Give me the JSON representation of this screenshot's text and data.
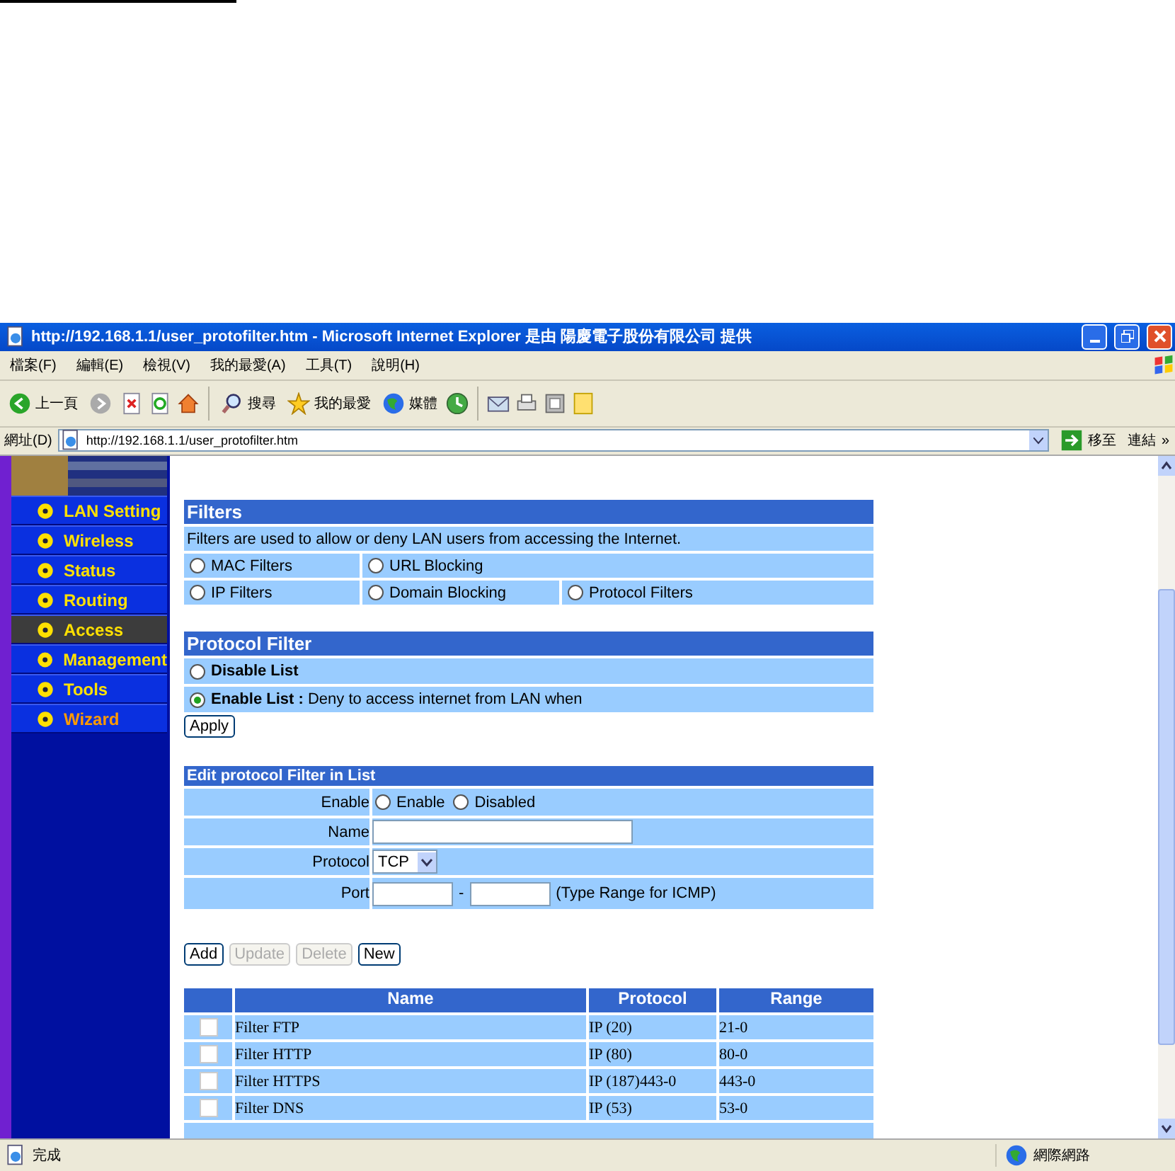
{
  "window": {
    "title": "http://192.168.1.1/user_protofilter.htm - Microsoft Internet Explorer 是由 陽慶電子股份有限公司 提供"
  },
  "menu": [
    "檔案(F)",
    "編輯(E)",
    "檢視(V)",
    "我的最愛(A)",
    "工具(T)",
    "說明(H)"
  ],
  "toolbar": {
    "back": "上一頁",
    "search": "搜尋",
    "favorites": "我的最愛",
    "media": "媒體"
  },
  "address": {
    "label": "網址(D)",
    "url": "http://192.168.1.1/user_protofilter.htm",
    "go": "移至",
    "links": "連結",
    "more": "»"
  },
  "sidebar": {
    "items": [
      {
        "label": "LAN Setting",
        "selected": false
      },
      {
        "label": "Wireless",
        "selected": false
      },
      {
        "label": "Status",
        "selected": false
      },
      {
        "label": "Routing",
        "selected": false
      },
      {
        "label": "Access",
        "selected": true
      },
      {
        "label": "Management",
        "selected": false
      },
      {
        "label": "Tools",
        "selected": false
      },
      {
        "label": "Wizard",
        "selected": false
      }
    ]
  },
  "filters": {
    "title": "Filters",
    "description": "Filters are used to allow or deny LAN users from accessing the Internet.",
    "options": [
      {
        "label": "MAC Filters",
        "selected": false
      },
      {
        "label": "URL Blocking",
        "selected": false
      },
      {
        "label": "IP Filters",
        "selected": false
      },
      {
        "label": "Domain Blocking",
        "selected": false
      },
      {
        "label": "Protocol Filters",
        "selected": false
      }
    ]
  },
  "protocol_filter": {
    "title": "Protocol Filter",
    "options": [
      {
        "label": "Disable List",
        "selected": false
      },
      {
        "label": "**Enable List :** Deny to access internet from LAN when",
        "selected": true
      }
    ],
    "apply": "Apply"
  },
  "edit": {
    "title": "Edit protocol Filter in List",
    "enable_label": "Enable",
    "enable_options": [
      {
        "label": "Enable",
        "selected": false
      },
      {
        "label": "Disabled",
        "selected": false
      }
    ],
    "name_label": "Name",
    "protocol_label": "Protocol",
    "protocol_value": "TCP",
    "port_label": "Port",
    "port_separator": "-",
    "port_hint": "(Type Range for ICMP)"
  },
  "buttons": [
    {
      "label": "Add",
      "disabled": false
    },
    {
      "label": "Update",
      "disabled": true
    },
    {
      "label": "Delete",
      "disabled": true
    },
    {
      "label": "New",
      "disabled": false
    }
  ],
  "table": {
    "columns": [
      "Name",
      "Protocol",
      "Range"
    ],
    "rows": [
      {
        "checked": false,
        "name": "Filter FTP",
        "protocol": "IP (20)",
        "range": "21-0"
      },
      {
        "checked": false,
        "name": "Filter HTTP",
        "protocol": "IP (80)",
        "range": "80-0"
      },
      {
        "checked": false,
        "name": "Filter HTTPS",
        "protocol": "IP (187)443-0",
        "range": "443-0"
      },
      {
        "checked": false,
        "name": "Filter DNS",
        "protocol": "IP (53)",
        "range": "53-0"
      }
    ]
  },
  "status_bar": {
    "text": "完成",
    "zone": "網際網路"
  }
}
